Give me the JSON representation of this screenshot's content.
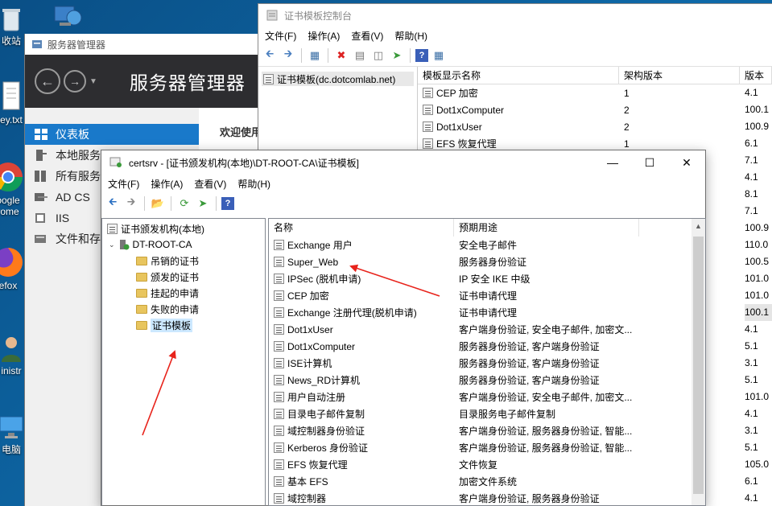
{
  "desktop": {
    "icons": [
      {
        "name": "recycle-bin",
        "label": "收站"
      },
      {
        "name": "text-file",
        "label": "ey.txt"
      },
      {
        "name": "chrome",
        "label": "oogle"
      },
      {
        "name": "chrome-sub",
        "label": "rome"
      },
      {
        "name": "firefox",
        "label": "efox"
      },
      {
        "name": "admin",
        "label": "inistr"
      },
      {
        "name": "this-pc",
        "label": "电脑"
      }
    ]
  },
  "server_manager": {
    "title": "服务器管理器",
    "header_title": "服务器管理器",
    "welcome": "欢迎使用",
    "nav": [
      {
        "label": "仪表板",
        "icon": "dashboard-icon"
      },
      {
        "label": "本地服务",
        "icon": "local-server-icon"
      },
      {
        "label": "所有服务",
        "icon": "all-servers-icon"
      },
      {
        "label": "AD CS",
        "icon": "adcs-icon"
      },
      {
        "label": "IIS",
        "icon": "iis-icon"
      },
      {
        "label": "文件和存",
        "icon": "file-storage-icon"
      }
    ]
  },
  "ctc": {
    "title": "证书模板控制台",
    "menu": [
      "文件(F)",
      "操作(A)",
      "查看(V)",
      "帮助(H)"
    ],
    "tree_node": "证书模板(dc.dotcomlab.net)",
    "columns": [
      "模板显示名称",
      "架构版本",
      "版本"
    ],
    "rows": [
      {
        "name": "CEP 加密",
        "schema": "1"
      },
      {
        "name": "Dot1xComputer",
        "schema": "2"
      },
      {
        "name": "Dot1xUser",
        "schema": "2"
      },
      {
        "name": "EFS 恢复代理",
        "schema": "1"
      }
    ],
    "versions": [
      "4.1",
      "100.1",
      "100.9",
      "6.1",
      "7.1",
      "4.1",
      "8.1",
      "7.1",
      "100.9",
      "110.0",
      "100.5",
      "101.0",
      "101.0",
      "100.1",
      "4.1",
      "5.1",
      "3.1",
      "5.1",
      "101.0",
      "4.1",
      "3.1",
      "5.1",
      "105.0",
      "6.1",
      "4.1"
    ]
  },
  "certsrv": {
    "title": "certsrv - [证书颁发机构(本地)\\DT-ROOT-CA\\证书模板]",
    "menu": [
      "文件(F)",
      "操作(A)",
      "查看(V)",
      "帮助(H)"
    ],
    "tree": {
      "root": "证书颁发机构(本地)",
      "ca": "DT-ROOT-CA",
      "folders": [
        "吊销的证书",
        "颁发的证书",
        "挂起的申请",
        "失败的申请",
        "证书模板"
      ]
    },
    "columns": [
      "名称",
      "预期用途"
    ],
    "rows": [
      {
        "name": "Exchange 用户",
        "purpose": "安全电子邮件"
      },
      {
        "name": "Super_Web",
        "purpose": "服务器身份验证"
      },
      {
        "name": "IPSec (脱机申请)",
        "purpose": "IP 安全 IKE 中级"
      },
      {
        "name": "CEP 加密",
        "purpose": "证书申请代理"
      },
      {
        "name": "Exchange 注册代理(脱机申请)",
        "purpose": "证书申请代理"
      },
      {
        "name": "Dot1xUser",
        "purpose": "客户端身份验证, 安全电子邮件, 加密文..."
      },
      {
        "name": "Dot1xComputer",
        "purpose": "服务器身份验证, 客户端身份验证"
      },
      {
        "name": "ISE计算机",
        "purpose": "服务器身份验证, 客户端身份验证"
      },
      {
        "name": "News_RD计算机",
        "purpose": "服务器身份验证, 客户端身份验证"
      },
      {
        "name": "用户自动注册",
        "purpose": "客户端身份验证, 安全电子邮件, 加密文..."
      },
      {
        "name": "目录电子邮件复制",
        "purpose": "目录服务电子邮件复制"
      },
      {
        "name": "域控制器身份验证",
        "purpose": "客户端身份验证, 服务器身份验证, 智能..."
      },
      {
        "name": "Kerberos 身份验证",
        "purpose": "客户端身份验证, 服务器身份验证, 智能..."
      },
      {
        "name": "EFS 恢复代理",
        "purpose": "文件恢复"
      },
      {
        "name": "基本 EFS",
        "purpose": "加密文件系统"
      },
      {
        "name": "域控制器",
        "purpose": "客户端身份验证, 服务器身份验证"
      }
    ]
  },
  "colors": {
    "accent": "#1979ca",
    "arrow": "#e8231b",
    "sm_header": "#2d2d30"
  }
}
